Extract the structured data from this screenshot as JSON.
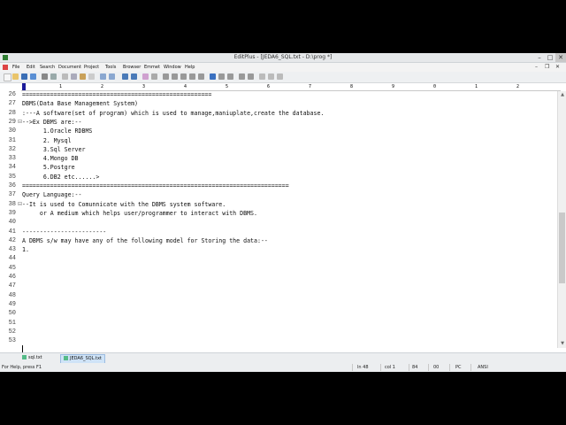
{
  "window": {
    "title": "EditPlus - [JEDA6_SQL.txt - D:\\prog *]"
  },
  "menu": [
    "File",
    "Edit",
    "Search",
    "Document",
    "Project",
    "Tools",
    "Browser",
    "Emmet",
    "Window",
    "Help"
  ],
  "ruler": {
    "numbers": [
      "1",
      "2",
      "3",
      "4",
      "5",
      "6",
      "7",
      "8",
      "9",
      "0",
      "1",
      "2"
    ]
  },
  "lines": [
    {
      "n": "26",
      "text": "======================================================"
    },
    {
      "n": "27",
      "text": "DBMS(Data Base Management System)"
    },
    {
      "n": "28",
      "text": ":---A software(set of program) which is used to manage,maniuplate,create the database."
    },
    {
      "n": "29",
      "text": "-->Ex DBMS are:--"
    },
    {
      "n": "30",
      "text": "      1.Oracle RDBMS"
    },
    {
      "n": "31",
      "text": "      2. Mysql"
    },
    {
      "n": "32",
      "text": "      3.Sql Server"
    },
    {
      "n": "33",
      "text": "      4.Mongo DB"
    },
    {
      "n": "34",
      "text": "      5.Postgre"
    },
    {
      "n": "35",
      "text": "      6.DB2 etc......>"
    },
    {
      "n": "36",
      "text": "============================================================================"
    },
    {
      "n": "37",
      "text": "Query Language:--"
    },
    {
      "n": "38",
      "text": "--It is used to Comunnicate with the DBMS system software."
    },
    {
      "n": "39",
      "text": "     or A medium which helps user/programmer to interact with DBMS."
    },
    {
      "n": "40",
      "text": ""
    },
    {
      "n": "41",
      "text": "------------------------"
    },
    {
      "n": "42",
      "text": "A DBMS s/w may have any of the following model for Storing the data:--"
    },
    {
      "n": "43",
      "text": "1."
    },
    {
      "n": "44",
      "text": ""
    },
    {
      "n": "45",
      "text": ""
    },
    {
      "n": "46",
      "text": ""
    },
    {
      "n": "47",
      "text": ""
    },
    {
      "n": "48",
      "text": ""
    },
    {
      "n": "49",
      "text": ""
    },
    {
      "n": "50",
      "text": ""
    },
    {
      "n": "51",
      "text": ""
    },
    {
      "n": "52",
      "text": ""
    },
    {
      "n": "53",
      "text": ""
    }
  ],
  "tabs": [
    {
      "label": "sql.txt",
      "active": false
    },
    {
      "label": "JEDA6_SQL.txt",
      "active": true
    }
  ],
  "status": {
    "help": "For Help, press F1",
    "line": "ln 48",
    "col": "col 1",
    "num1": "84",
    "num2": "00",
    "pc": "PC",
    "encoding": "ANSI"
  }
}
